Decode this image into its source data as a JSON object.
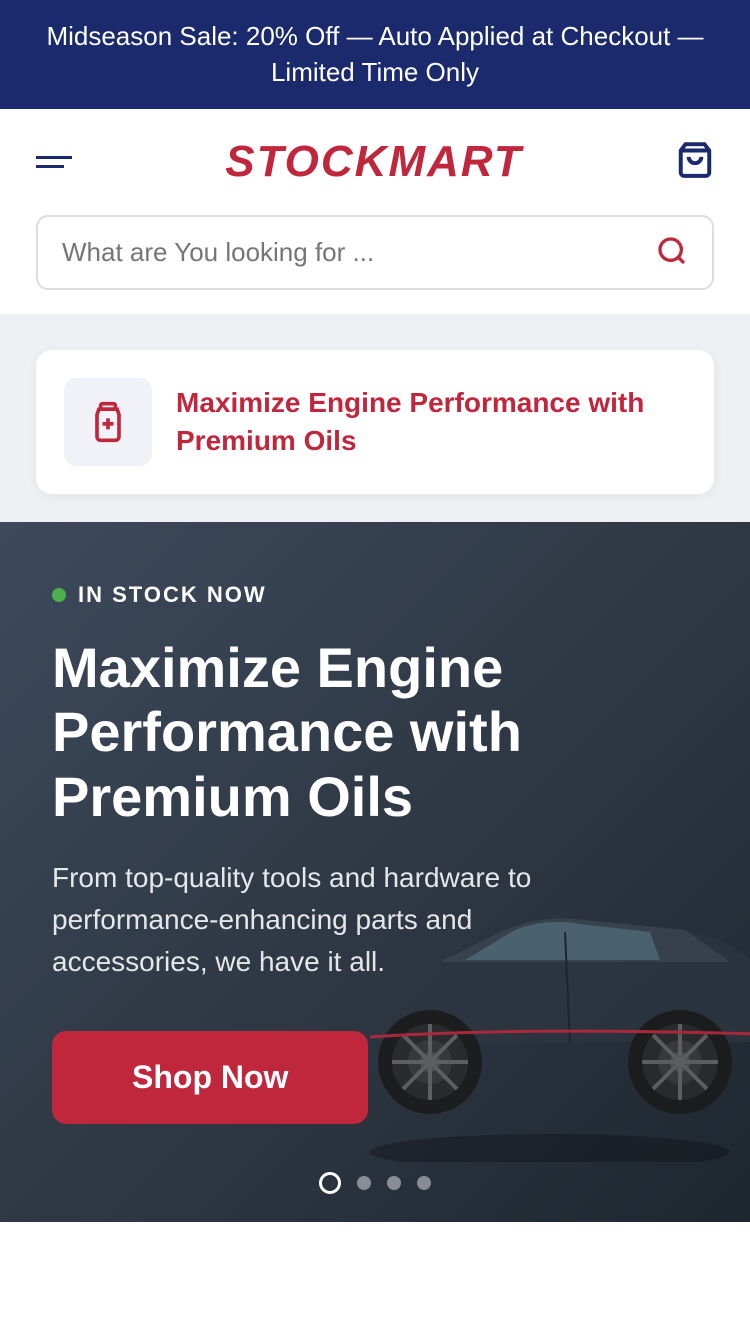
{
  "banner": {
    "text": "Midseason Sale: 20% Off — Auto Applied at Checkout — Limited Time Only"
  },
  "header": {
    "logo": "STOCKMART",
    "cart_label": "Cart"
  },
  "search": {
    "placeholder": "What are You looking for ..."
  },
  "product_card": {
    "title": "Maximize Engine Performance with Premium Oils",
    "icon_label": "oil-bottle-icon"
  },
  "hero": {
    "in_stock_label": "IN STOCK NOW",
    "title": "Maximize Engine Performance with Premium Oils",
    "description": "From top-quality tools and hardware to performance-enhancing parts and accessories, we have it all.",
    "cta_label": "Shop Now"
  },
  "pagination": {
    "dots": [
      "active",
      "inactive",
      "inactive",
      "inactive"
    ]
  }
}
